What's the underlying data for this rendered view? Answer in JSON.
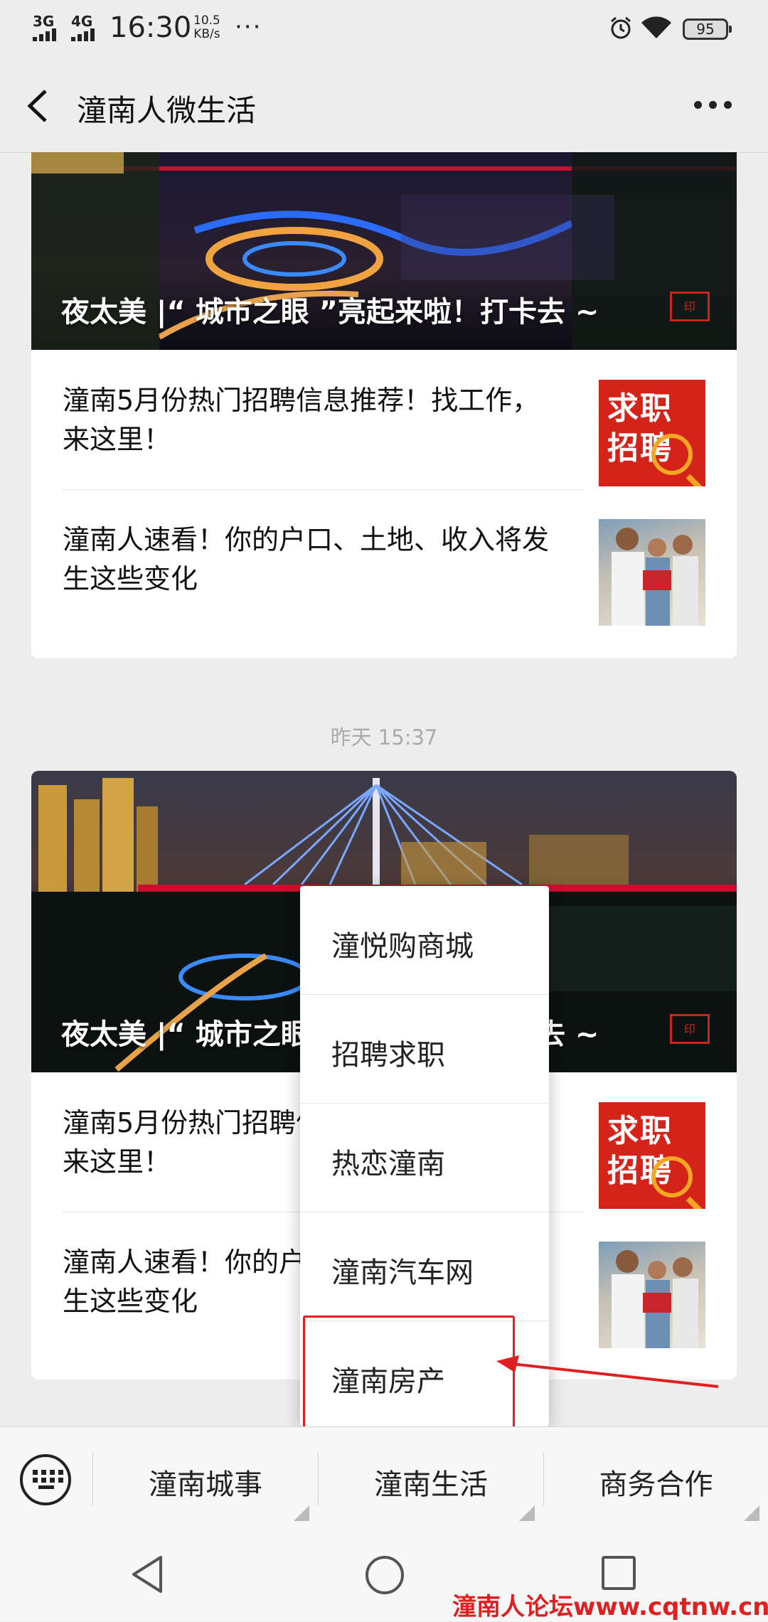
{
  "status_bar": {
    "network_1": "3G",
    "network_2": "4G",
    "time": "16:30",
    "speed_value": "10.5",
    "speed_unit": "KB/s",
    "more": "···",
    "battery": "95"
  },
  "nav": {
    "title": "潼南人微生活"
  },
  "article_groups": [
    {
      "cover_title": "夜太美 |“ 城市之眼 ”亮起来啦！打卡去 ~",
      "items": [
        {
          "title": "潼南5月份热门招聘信息推荐！找工作，来这里！",
          "thumb_line1": "求职",
          "thumb_line2": "招聘"
        },
        {
          "title": "潼南人速看！你的户口、土地、收入将发生这些变化"
        }
      ]
    },
    {
      "cover_title": "夜太美 |“ 城市之眼 ”亮起来啦！打卡去 ~",
      "items": [
        {
          "title": "潼南5月份热门招聘信息推荐！找工作，来这里！",
          "thumb_line1": "求职",
          "thumb_line2": "招聘"
        },
        {
          "title": "潼南人速看！你的户口、土地、收入将发生这些变化"
        }
      ]
    }
  ],
  "timestamp": "昨天 15:37",
  "popup_menu": {
    "items": [
      "潼悦购商城",
      "招聘求职",
      "热恋潼南",
      "潼南汽车网",
      "潼南房产"
    ],
    "highlighted_index": 4
  },
  "bottom_menu": {
    "items": [
      "潼南城事",
      "潼南生活",
      "商务合作"
    ]
  },
  "watermark": "潼南人论坛www.cqtnw.cn",
  "colors": {
    "background": "#ededed",
    "highlight": "#e02020",
    "thumb_red": "#d42318"
  }
}
